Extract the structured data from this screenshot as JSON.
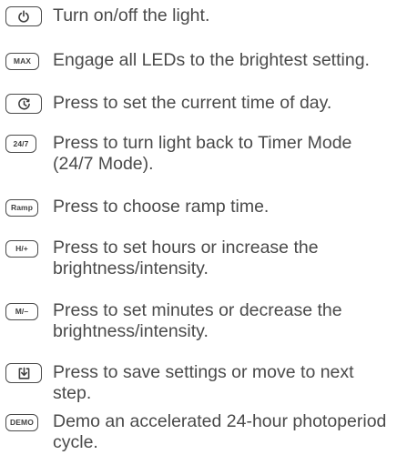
{
  "items": [
    {
      "key_label": "",
      "key_icon": "power-icon",
      "text": "Turn on/off the light."
    },
    {
      "key_label": "MAX",
      "key_icon": "",
      "text": "Engage all LEDs to the brightest setting."
    },
    {
      "key_label": "",
      "key_icon": "clock-icon",
      "text": "Press to set the current time of day."
    },
    {
      "key_label": "24/7",
      "key_icon": "",
      "text": "Press to turn light back to Timer Mode (24/7 Mode)."
    },
    {
      "key_label": "Ramp",
      "key_icon": "",
      "text": "Press to choose ramp time."
    },
    {
      "key_label": "H/+",
      "key_icon": "",
      "text": "Press to set hours or increase the brightness/intensity."
    },
    {
      "key_label": "M/–",
      "key_icon": "",
      "text": "Press to set minutes or decrease the brightness/intensity."
    },
    {
      "key_label": "",
      "key_icon": "save-icon",
      "text": "Press to save settings or move to next step."
    },
    {
      "key_label": "DEMO",
      "key_icon": "",
      "text": "Demo an accelerated 24-hour photoperiod cycle."
    }
  ]
}
